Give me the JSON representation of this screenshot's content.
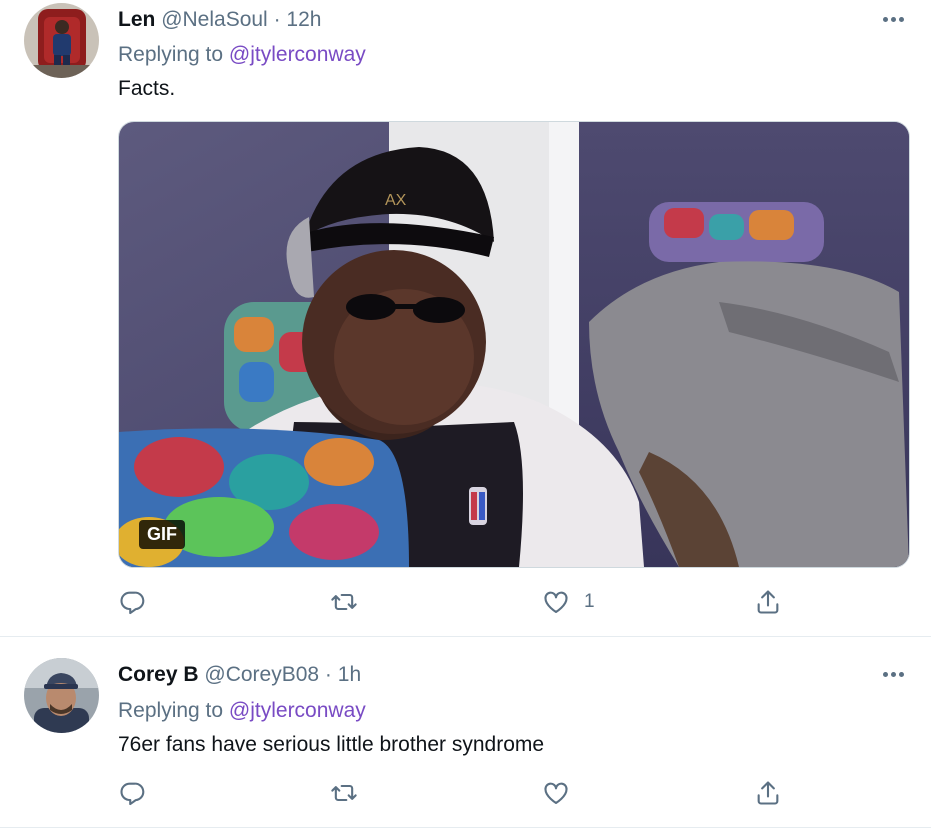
{
  "tweets": [
    {
      "name": "Len",
      "handle": "@NelaSoul",
      "separator": "·",
      "time": "12h",
      "replying_prefix": "Replying to",
      "replying_to": "@jtylerconway",
      "text": "Facts.",
      "media_badge": "GIF",
      "actions": {
        "reply_count": "",
        "retweet_count": "",
        "like_count": "1"
      }
    },
    {
      "name": "Corey B",
      "handle": "@CoreyB08",
      "separator": "·",
      "time": "1h",
      "replying_prefix": "Replying to",
      "replying_to": "@jtylerconway",
      "text": "76er fans have serious little brother syndrome",
      "actions": {
        "reply_count": "",
        "retweet_count": "",
        "like_count": ""
      }
    }
  ],
  "icons": {
    "reply": "reply-icon",
    "retweet": "retweet-icon",
    "like": "heart-icon",
    "share": "share-icon",
    "more": "more-icon"
  },
  "colors": {
    "text": "#0f1419",
    "secondary": "#5b7083",
    "mention": "#794bc4",
    "divider": "#e6ecf0"
  }
}
